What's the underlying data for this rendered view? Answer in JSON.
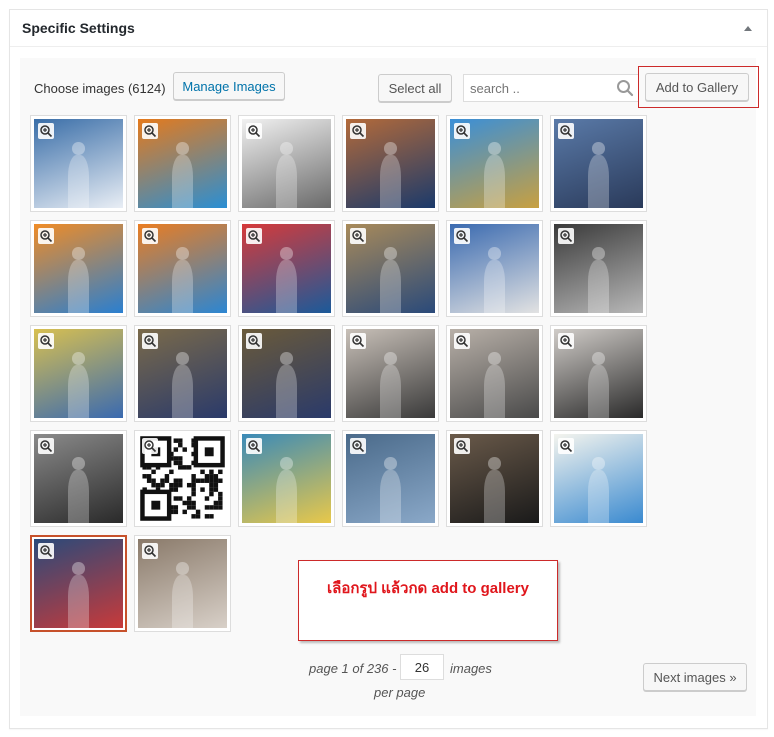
{
  "panel": {
    "title": "Specific Settings"
  },
  "toolbar": {
    "choose_label": "Choose images (6124)",
    "manage_label": "Manage Images",
    "select_all_label": "Select all",
    "search_placeholder": "search ..",
    "add_gallery_label": "Add to Gallery"
  },
  "images": [
    {
      "name": "canada-city-banner",
      "bg": "#3a6ea8",
      "accent": "#e9eef5",
      "selected": false
    },
    {
      "name": "congratulations-orange-1",
      "bg": "#e57a1c",
      "accent": "#2a8fd4",
      "selected": false
    },
    {
      "name": "congratulations-dubai",
      "bg": "#f1f1f1",
      "accent": "#6a6a6a",
      "selected": false
    },
    {
      "name": "congratulations-london",
      "bg": "#b36a3a",
      "accent": "#1b3a6b",
      "selected": false
    },
    {
      "name": "congratulations-blue-sky",
      "bg": "#3a8fd8",
      "accent": "#c8a040",
      "selected": false
    },
    {
      "name": "congratulations-bigben",
      "bg": "#5a7aa8",
      "accent": "#2a3a5a",
      "selected": false
    },
    {
      "name": "congratulations-orange-2",
      "bg": "#f08c26",
      "accent": "#2a7fd0",
      "selected": false
    },
    {
      "name": "congratulations-orange-3",
      "bg": "#ea7d22",
      "accent": "#2c86d2",
      "selected": false
    },
    {
      "name": "tsab-logo-photo",
      "bg": "#d63a3a",
      "accent": "#1b5a9a",
      "selected": false
    },
    {
      "name": "student-with-certificate",
      "bg": "#a88a5a",
      "accent": "#2a4a7a",
      "selected": false
    },
    {
      "name": "student-tsab-board",
      "bg": "#3a6ab0",
      "accent": "#e2e2e2",
      "selected": false
    },
    {
      "name": "student-dark-room",
      "bg": "#3a3a3a",
      "accent": "#b8b8b8",
      "selected": false
    },
    {
      "name": "tsab-booth-student",
      "bg": "#d8c050",
      "accent": "#3a6ab0",
      "selected": false
    },
    {
      "name": "group-table-1",
      "bg": "#7a6a4a",
      "accent": "#2a3a6a",
      "selected": false
    },
    {
      "name": "group-table-2",
      "bg": "#6a5a3a",
      "accent": "#2a3a6a",
      "selected": false
    },
    {
      "name": "expo-booth-1",
      "bg": "#c8c0b8",
      "accent": "#3a3a3a",
      "selected": false
    },
    {
      "name": "expo-booth-2",
      "bg": "#b8b0a8",
      "accent": "#4a4a4a",
      "selected": false
    },
    {
      "name": "expo-booth-3",
      "bg": "#d0ccc8",
      "accent": "#2a2a2a",
      "selected": false
    },
    {
      "name": "expo-crowd",
      "bg": "#8a8a8a",
      "accent": "#2a2a2a",
      "selected": false
    },
    {
      "name": "qr-code",
      "bg": "#ffffff",
      "accent": "#111111",
      "selected": false
    },
    {
      "name": "dubai-promo",
      "bg": "#3a8ab8",
      "accent": "#e8c84a",
      "selected": false
    },
    {
      "name": "jeans-pocket",
      "bg": "#4a6a8a",
      "accent": "#8aa8c8",
      "selected": false
    },
    {
      "name": "graduation-hug",
      "bg": "#6a5a4a",
      "accent": "#1a1a1a",
      "selected": false
    },
    {
      "name": "labor-cartoon",
      "bg": "#f4f4ee",
      "accent": "#3a8ad0",
      "selected": false
    },
    {
      "name": "airport-traveler",
      "bg": "#2a4a7a",
      "accent": "#c83a3a",
      "selected": true
    },
    {
      "name": "woman-writing",
      "bg": "#8a7a6a",
      "accent": "#d8d0c8",
      "selected": false
    }
  ],
  "annotation": {
    "text": "เลือกรูป แล้วกด add to gallery"
  },
  "pager": {
    "page_text": "page 1 of 236 -",
    "per_page_value": "26",
    "images_text": "images",
    "per_page_text": "per page",
    "next_label": "Next images »"
  },
  "colors": {
    "accent_link": "#0073aa",
    "highlight_red": "#cc2a2a",
    "selected_border": "#c7512b"
  }
}
